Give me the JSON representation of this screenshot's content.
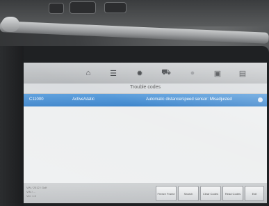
{
  "toolbar": {
    "icons": [
      "home-icon",
      "sliders-icon",
      "settings-icon",
      "vehicle-icon",
      "record-icon",
      "save-icon",
      "print-icon"
    ]
  },
  "screen": {
    "title": "Trouble codes"
  },
  "dtc_list": [
    {
      "code": "C11000",
      "status": "Active/static",
      "description": "Automatic distance/speed sensor: Misadjusted"
    }
  ],
  "footer": {
    "vehicle_info_lines": [
      "VW / 2012 / Golf",
      "VIN / ...",
      "Ver: 1.0"
    ],
    "buttons": [
      "Freeze Frame",
      "Search",
      "Clear Codes",
      "Read Codes",
      "Exit"
    ]
  }
}
